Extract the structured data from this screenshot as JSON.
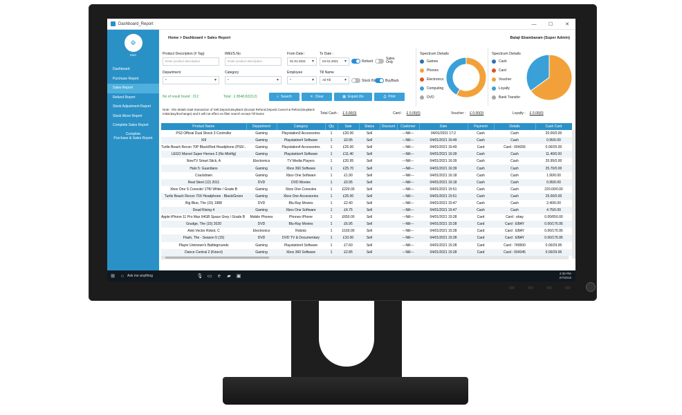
{
  "window": {
    "title": "Dashboard_Report",
    "minimize": "—",
    "maximize": "☐",
    "close": "✕"
  },
  "sidebar": {
    "logo_text": "RMS",
    "items": [
      {
        "label": "Dashboard"
      },
      {
        "label": "Purchase Report"
      },
      {
        "label": "Sales Report"
      },
      {
        "label": "Refund Report"
      },
      {
        "label": "Stock Adjustment Report"
      },
      {
        "label": "Stock Move Report"
      },
      {
        "label": "Complete Sales Report"
      },
      {
        "label1": "Complete",
        "label2": "Purchase & Sales Report"
      }
    ]
  },
  "header": {
    "breadcrumb": "Home > Dashboard > Sales Report",
    "user": "Balaji Ekambaram (Super Admin)"
  },
  "filters": {
    "product_label": "Product Description (# Tag)",
    "product_placeholder": "Enter product description",
    "imei_label": "IMEI/S.No",
    "imei_placeholder": "Enter product description",
    "from_label": "From Date :",
    "from_value": "01-01-2021",
    "to_label": "To Date :",
    "to_value": "04-01-2021",
    "refund_label": "Refund",
    "sales_only_label1": "Sales",
    "sales_only_label2": "Only",
    "department_label": "Department",
    "department_value": "*",
    "category_label": "Category",
    "category_value": "*",
    "employee_label": "Employee",
    "employee_value": "*",
    "till_label": "Till Name",
    "till_value": "All Till",
    "stock_in_label": "Stock IN",
    "buyback_label": "BuyBack"
  },
  "results": {
    "found": "No of result found : 212",
    "total": "Total : £ 8548.82(212)"
  },
  "buttons": {
    "search": "Search",
    "clear": "Clear",
    "export": "Export.Xls",
    "print": "Print"
  },
  "spectrum_left": {
    "title": "Spectrum Details",
    "items": [
      {
        "label": "Games",
        "color": "#2f6fb5"
      },
      {
        "label": "Phones",
        "color": "#f2a13a"
      },
      {
        "label": "Electronics",
        "color": "#e0541e"
      },
      {
        "label": "Computing",
        "color": "#3aa0d8"
      },
      {
        "label": "DVD",
        "color": "#a6a6a6"
      }
    ]
  },
  "spectrum_right": {
    "title": "Spectrum Details",
    "items": [
      {
        "label": "Cash",
        "color": "#2f6fb5"
      },
      {
        "label": "Card",
        "color": "#e0541e"
      },
      {
        "label": "Voucher",
        "color": "#f2a13a"
      },
      {
        "label": "Loyalty",
        "color": "#3aa0d8"
      },
      {
        "label": "Bank Transfer",
        "color": "#a6a6a6"
      }
    ]
  },
  "chart_data": [
    {
      "type": "pie",
      "variant": "donut",
      "labels": [
        "Games",
        "Phones",
        "Electronics",
        "Computing",
        "DVD"
      ],
      "values": [
        0,
        58,
        0,
        42,
        0
      ]
    },
    {
      "type": "pie",
      "labels": [
        "Cash",
        "Card",
        "Voucher",
        "Loyalty",
        "Bank Transfer"
      ],
      "values": [
        0,
        0,
        65,
        35,
        0
      ]
    }
  ],
  "note": "Note : this details total transaction of Sell,Deposit,BuyBack (Except Refund,Deposit Cancel & Refund,BuyBack Initial,Buy/Exchange) and it will not effect on filter search except Till Name",
  "totals": {
    "cash_label": "Total Cash :",
    "cash": "£ 0.00(0)",
    "card_label": "Card :",
    "card": "£ 0.00(0)",
    "voucher_label": "Voucher :",
    "voucher": "£ 0.00(0)",
    "loyalty_label": "Loyalty :",
    "loyalty": "£ 0.00(0)"
  },
  "table": {
    "columns": [
      "Product Name",
      "Department",
      "Category",
      "Qty",
      "Sale",
      "Status",
      "Discount",
      "Customer",
      "Date",
      "Payment",
      "Details",
      "Cash Card"
    ],
    "rows": [
      [
        "PS3 Official Dual Shock 3 Controller",
        "Gaming",
        "Playstation3 Accessories",
        "1",
        "£20.00",
        "Sell",
        "",
        "---Nill---",
        "04/01/2021 17:2",
        "Cash",
        "Cash",
        "20.00/0.00"
      ],
      [
        "XIII",
        "Gaming",
        "Playstation4 Software",
        "1",
        "£0.95",
        "Sell",
        "",
        "---Nill---",
        "04/01/2021 16:49",
        "Cash",
        "Cash",
        "0.95/0.00"
      ],
      [
        "Turtle Beach Recon 70P Black/Red Headphone (PS5/...",
        "Gaming",
        "Playstation4 Accessories",
        "1",
        "£25.00",
        "Sell",
        "",
        "---Nill---",
        "04/01/2021 16:49",
        "Card",
        "Card : 004266",
        "0.00/25.00"
      ],
      [
        "LEGO Marvel Super Heroes 2 (No Minifig)",
        "Gaming",
        "Playstation4 Software",
        "1",
        "£11.40",
        "Sell",
        "",
        "---Nill---",
        "04/01/2021 16:39",
        "Cash",
        "Cash",
        "11.40/0.00"
      ],
      [
        "NowTV Smart Stick, A",
        "Electronics",
        "TV Media Players",
        "1",
        "£20.95",
        "Sell",
        "",
        "---Nill---",
        "04/01/2021 16:39",
        "Cash",
        "Cash",
        "20.95/0.00"
      ],
      [
        "Halo 5: Guardians",
        "Gaming",
        "Xbox 360 Software",
        "1",
        "£25.70",
        "Sell",
        "",
        "---Nill---",
        "04/01/2021 16:39",
        "Cash",
        "Cash",
        "25.70/0.00"
      ],
      [
        "Crackdown",
        "Gaming",
        "Xbox One Software",
        "1",
        "£1.90",
        "Sell",
        "",
        "---Nill---",
        "04/01/2021 16:18",
        "Cash",
        "Cash",
        "1.90/0.00"
      ],
      [
        "Real Steel (12) 2011",
        "DVD",
        "DVD Movies",
        "1",
        "£0.95",
        "Sell",
        "",
        "---Nill---",
        "04/01/2021 16:18",
        "Cash",
        "Cash",
        "0.95/0.00"
      ],
      [
        "Xbox One S Console/ 1TB/ White / Grade B",
        "Gaming",
        "Xbox One Consoles",
        "1",
        "£220.00",
        "Sell",
        "",
        "---Nill---",
        "04/01/2021 15:51",
        "Cash",
        "Cash",
        "220.00/0.00"
      ],
      [
        "Turtle Beach Recon 70X Headphone - Black/Green",
        "Gaming",
        "Xbox One Accessories",
        "1",
        "£25.00",
        "Sell",
        "",
        "---Nill---",
        "04/01/2021 15:51",
        "Cash",
        "Cash",
        "25.00/0.00"
      ],
      [
        "Big Blue, The (15) 1988",
        "DVD",
        "Blu-Ray Movies",
        "1",
        "£2.40",
        "Sell",
        "",
        "---Nill---",
        "04/01/2021 15:47",
        "Cash",
        "Cash",
        "2.40/0.00"
      ],
      [
        "Dead Rising 4",
        "Gaming",
        "Xbox One Software",
        "1",
        "£4.75",
        "Sell",
        "",
        "---Nill---",
        "04/01/2021 15:47",
        "Cash",
        "Cash",
        "4.75/0.00"
      ],
      [
        "Apple iPhone 11 Pro Max 64GB Space Grey / Grade B ...",
        "Mobile Phones",
        "Phones iPhone",
        "1",
        "£650.00",
        "Sell",
        "",
        "---Nill---",
        "04/01/2021 15:28",
        "Card",
        "Card : ebay",
        "0.00/650.00"
      ],
      [
        "Grudge, The (15) 2020",
        "DVD",
        "Blu-Ray Movies",
        "1",
        "£6.95",
        "Sell",
        "",
        "---Nill---",
        "04/01/2021 15:28",
        "Card",
        "Card : EBAY",
        "0.00/176.95"
      ],
      [
        "Anki Vector Robot, C",
        "Electronics",
        "Robots",
        "1",
        "£160.00",
        "Sell",
        "",
        "---Nill---",
        "04/01/2021 15:28",
        "Card",
        "Card : EBAY",
        "0.00/176.95"
      ],
      [
        "Flash, The - Season 5 (15)",
        "DVD",
        "DVD TV & Documentary",
        "1",
        "£10.00",
        "Sell",
        "",
        "---Nill---",
        "04/01/2021 15:28",
        "Card",
        "Card : EBAY",
        "0.00/176.95"
      ],
      [
        "Player Unknown's Battlegrounds",
        "Gaming",
        "Playstation4 Software",
        "1",
        "£7.60",
        "Sell",
        "",
        "---Nill---",
        "04/01/2021 15:28",
        "Card",
        "Card : 749500",
        "0.00/29.95"
      ],
      [
        "Dance Central 2 (Kinect)",
        "Gaming",
        "Xbox 360 Software",
        "1",
        "£2.85",
        "Sell",
        "",
        "---Nill---",
        "04/01/2021 15:28",
        "Card",
        "Card : 004345",
        "0.00/29.95"
      ],
      [
        "",
        "",
        "",
        "",
        "",
        "",
        "",
        "",
        "",
        "",
        "",
        ""
      ]
    ]
  },
  "taskbar": {
    "search": "Ask me anything",
    "time": "2:30 PM",
    "date": "2/7/2015"
  }
}
